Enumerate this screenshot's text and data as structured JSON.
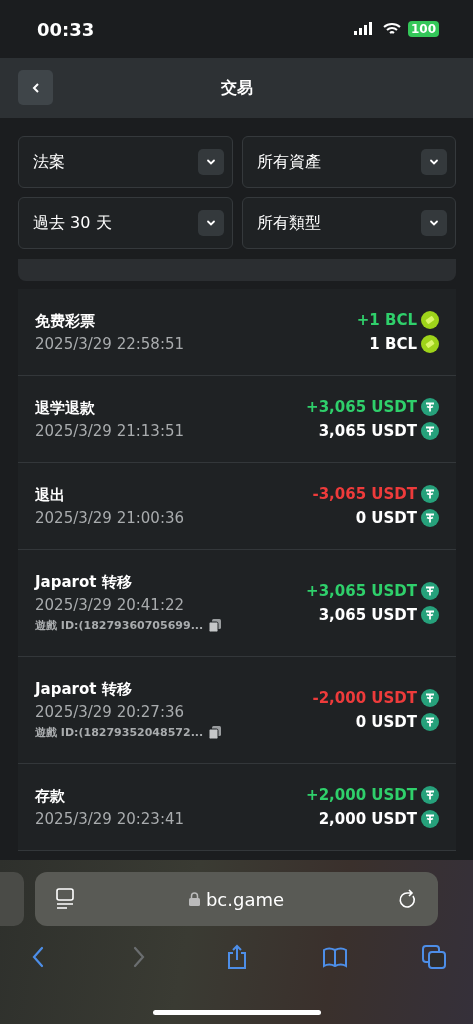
{
  "status_bar": {
    "time": "00:33",
    "battery": "100"
  },
  "nav": {
    "title": "交易"
  },
  "filters": [
    {
      "label": "法案"
    },
    {
      "label": "所有資產"
    },
    {
      "label": "過去 30 天"
    },
    {
      "label": "所有類型"
    }
  ],
  "transactions": [
    {
      "title": "免费彩票",
      "time": "2025/3/29 22:58:51",
      "amount": "+1 BCL",
      "kind": "credit",
      "balance": "1 BCL",
      "coin": {
        "kind": "bcl"
      }
    },
    {
      "title": "退学退款",
      "time": "2025/3/29 21:13:51",
      "amount": "+3,065 USDT",
      "kind": "credit",
      "balance": "3,065 USDT",
      "coin": {
        "kind": "usdt"
      }
    },
    {
      "title": "退出",
      "time": "2025/3/29 21:00:36",
      "amount": "-3,065 USDT",
      "kind": "debit",
      "balance": "0 USDT",
      "coin": {
        "kind": "usdt"
      }
    },
    {
      "title": "Japarot 转移",
      "time": "2025/3/29 20:41:22",
      "game_id": "遊戲 ID:(18279360705699...",
      "amount": "+3,065 USDT",
      "kind": "credit",
      "balance": "3,065 USDT",
      "coin": {
        "kind": "usdt"
      }
    },
    {
      "title": "Japarot 转移",
      "time": "2025/3/29 20:27:36",
      "game_id": "遊戲 ID:(18279352048572...",
      "amount": "-2,000 USDT",
      "kind": "debit",
      "balance": "0 USDT",
      "coin": {
        "kind": "usdt"
      }
    },
    {
      "title": "存款",
      "time": "2025/3/29 20:23:41",
      "amount": "+2,000 USDT",
      "kind": "credit",
      "balance": "2,000 USDT",
      "coin": {
        "kind": "usdt"
      }
    }
  ],
  "browser": {
    "url": "bc.game",
    "toolbar": [
      {
        "kind": "back",
        "disabled": false
      },
      {
        "kind": "forward",
        "disabled": true
      },
      {
        "kind": "share",
        "disabled": false
      },
      {
        "kind": "bookmarks",
        "disabled": false
      },
      {
        "kind": "tabs",
        "disabled": false
      }
    ]
  }
}
